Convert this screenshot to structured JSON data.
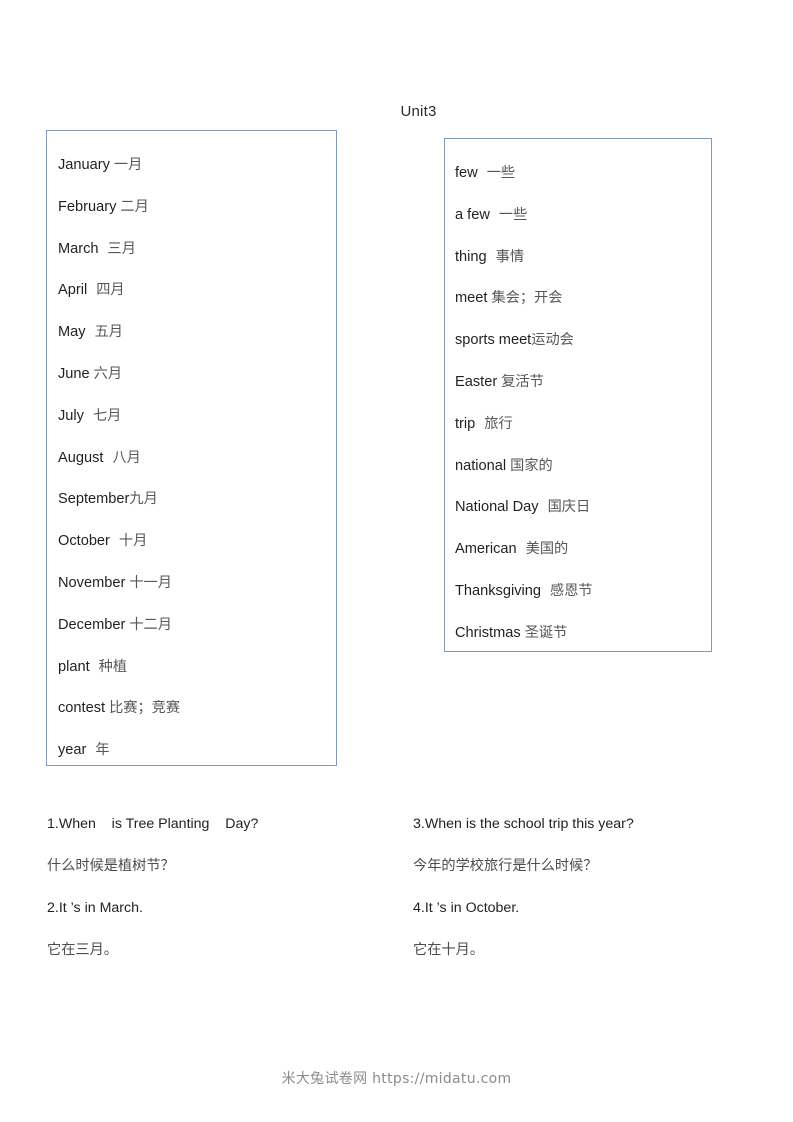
{
  "title": "Unit3",
  "vocab_left": {
    "items": [
      {
        "en": "January",
        "zh": "一月",
        "gap": "small"
      },
      {
        "en": "February",
        "zh": "二月",
        "gap": "small"
      },
      {
        "en": "March",
        "zh": "三月",
        "gap": "medium"
      },
      {
        "en": "April",
        "zh": "四月",
        "gap": "large"
      },
      {
        "en": "May",
        "zh": "五月",
        "gap": "medium"
      },
      {
        "en": "June",
        "zh": "六月",
        "gap": "small"
      },
      {
        "en": "July",
        "zh": "七月",
        "gap": "medium"
      },
      {
        "en": "August",
        "zh": "八月",
        "gap": "medium"
      },
      {
        "en": "September",
        "zh": "九月",
        "gap": "none"
      },
      {
        "en": "October",
        "zh": "十月",
        "gap": "medium"
      },
      {
        "en": "November",
        "zh": "十一月",
        "gap": "small"
      },
      {
        "en": "December",
        "zh": "十二月",
        "gap": "small"
      },
      {
        "en": "plant",
        "zh": "种植",
        "gap": "medium"
      },
      {
        "en": "contest",
        "zh": "比赛；竞赛",
        "gap": "small"
      },
      {
        "en": "year",
        "zh": "年",
        "gap": "medium"
      }
    ]
  },
  "vocab_right": {
    "items": [
      {
        "en": "few",
        "zh": "一些",
        "gap": "medium"
      },
      {
        "en": "a few",
        "zh": "一些",
        "gap": "medium"
      },
      {
        "en": "thing",
        "zh": "事情",
        "gap": "medium"
      },
      {
        "en": "meet",
        "zh": "集会；开会",
        "gap": "small"
      },
      {
        "en": "sports meet",
        "zh": "运动会",
        "gap": "none"
      },
      {
        "en": "Easter",
        "zh": "复活节",
        "gap": "small"
      },
      {
        "en": "trip",
        "zh": "旅行",
        "gap": "medium"
      },
      {
        "en": "national",
        "zh": "国家的",
        "gap": "small"
      },
      {
        "en": "National Day",
        "zh": "国庆日",
        "gap": "medium"
      },
      {
        "en": "American",
        "zh": "美国的",
        "gap": "medium"
      },
      {
        "en": "Thanksgiving",
        "zh": "感恩节",
        "gap": "medium"
      },
      {
        "en": "Christmas",
        "zh": "圣诞节",
        "gap": "small"
      }
    ]
  },
  "sentences": {
    "column_1": [
      {
        "en": "1.When    is Tree Planting    Day?",
        "zh": "什么时候是植树节？"
      },
      {
        "en": "2.It ’s in March.",
        "zh": "它在三月。"
      }
    ],
    "column_2": [
      {
        "en": "3.When is the school trip this year?",
        "zh": "今年的学校旅行是什么时候？"
      },
      {
        "en": "4.It ’s in October.",
        "zh": "它在十月。"
      }
    ]
  },
  "footer": {
    "watermark": "米大兔试卷网 https://midatu.com"
  },
  "colors": {
    "box_border": "#7e9cb6",
    "english_text": "#231f20",
    "chinese_text": "#5a5659",
    "watermark_text": "#8d8a8c",
    "page_background": "#ffffff"
  }
}
